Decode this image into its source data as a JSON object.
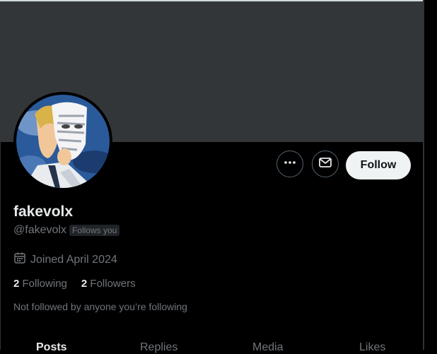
{
  "profile": {
    "display_name": "fakevolx",
    "handle": "@fakevolx",
    "follows_you_badge": "Follows you",
    "joined": "Joined April 2024",
    "following_count": "2",
    "following_label": "Following",
    "followers_count": "2",
    "followers_label": "Followers",
    "not_followed_note": "Not followed by anyone you’re following"
  },
  "actions": {
    "more_icon": "more-horizontal-icon",
    "message_icon": "envelope-icon",
    "follow_label": "Follow"
  },
  "tabs": [
    {
      "label": "Posts",
      "active": true
    },
    {
      "label": "Replies",
      "active": false
    },
    {
      "label": "Media",
      "active": false
    },
    {
      "label": "Likes",
      "active": false
    }
  ],
  "colors": {
    "banner": "#333639",
    "background": "#000000",
    "follow_button_bg": "#eff3f4",
    "muted_text": "#71767b"
  }
}
